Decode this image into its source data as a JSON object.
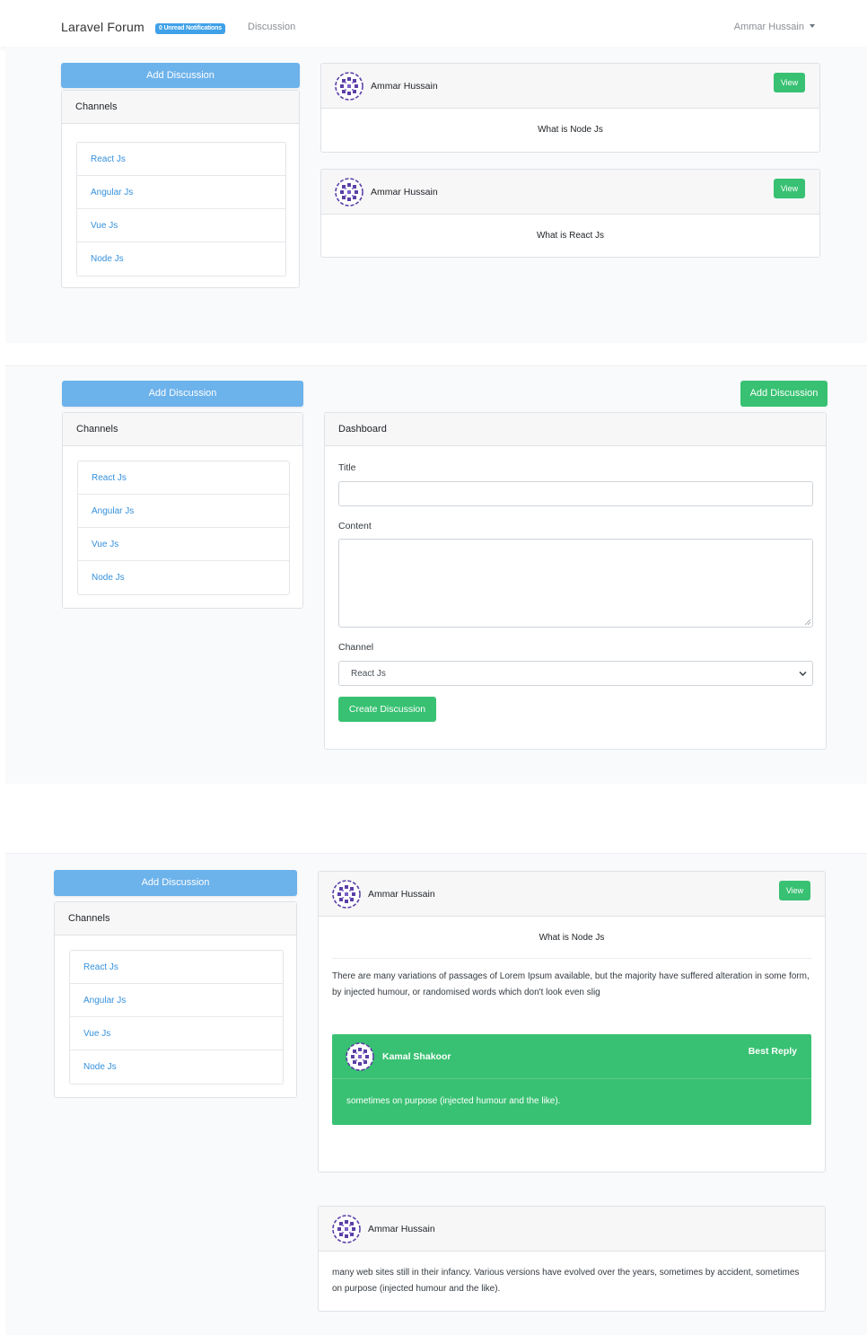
{
  "navbar": {
    "brand": "Laravel Forum",
    "notifications_badge": "0 Unread Notifications",
    "discussion_link": "Discussion",
    "user_menu": "Ammar Hussain"
  },
  "sidebar": {
    "add_discussion": "Add Discussion",
    "channels_header": "Channels",
    "channels": [
      "React Js",
      "Angular Js",
      "Vue Js",
      "Node Js"
    ]
  },
  "screen1": {
    "discussions": [
      {
        "author": "Ammar Hussain",
        "view_label": "View",
        "title": "What is Node Js"
      },
      {
        "author": "Ammar Hussain",
        "view_label": "View",
        "title": "What is React Js"
      }
    ]
  },
  "screen2": {
    "top_button": "Add Discussion",
    "card_header": "Dashboard",
    "title_label": "Title",
    "title_value": "",
    "content_label": "Content",
    "content_value": "",
    "channel_label": "Channel",
    "channel_selected": "React Js",
    "submit_label": "Create Discussion"
  },
  "screen3": {
    "discussion": {
      "author": "Ammar Hussain",
      "view_label": "View",
      "title": "What is Node Js",
      "content": "There are many variations of passages of Lorem Ipsum available, but the majority have suffered alteration in some form, by injected humour, or randomised words which don't look even slig"
    },
    "best_reply": {
      "author": "Kamal Shakoor",
      "badge": "Best Reply",
      "content": "sometimes on purpose (injected humour and the like)."
    },
    "reply": {
      "author": "Ammar Hussain",
      "content": "many web sites still in their infancy. Various versions have evolved over the years, sometimes by accident, sometimes on purpose (injected humour and the like)."
    }
  },
  "colors": {
    "primary_light": "#6cb2eb",
    "success": "#38c172",
    "link": "#3490dc",
    "avatar": "#5b3fa6"
  }
}
